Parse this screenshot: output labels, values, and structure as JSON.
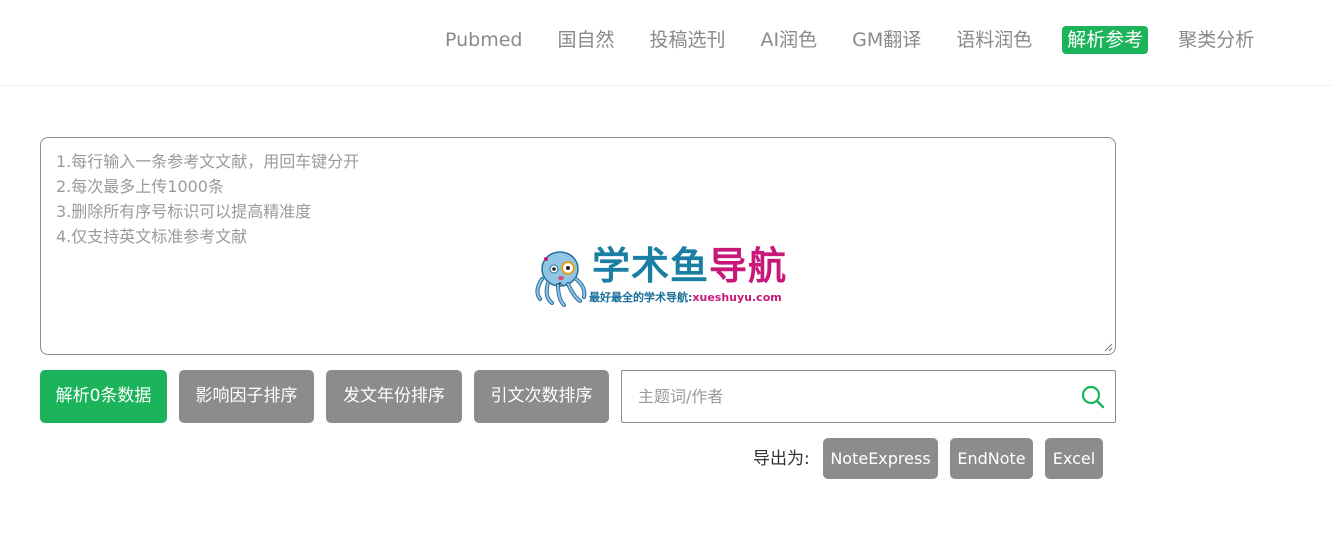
{
  "nav": {
    "items": [
      {
        "label": "Pubmed",
        "active": false
      },
      {
        "label": "国自然",
        "active": false
      },
      {
        "label": "投稿选刊",
        "active": false
      },
      {
        "label": "AI润色",
        "active": false
      },
      {
        "label": "GM翻译",
        "active": false
      },
      {
        "label": "语料润色",
        "active": false
      },
      {
        "label": "解析参考",
        "active": true
      },
      {
        "label": "聚类分析",
        "active": false
      }
    ]
  },
  "reference_input": {
    "value": "",
    "placeholder": "1.每行输入一条参考文文献，用回车键分开\n2.每次最多上传1000条\n3.删除所有序号标识可以提高精准度\n4.仅支持英文标准参考文献"
  },
  "watermark": {
    "title_part1": "学术鱼",
    "title_part2": "导航",
    "subtitle": "最好最全的学术导航:",
    "url": "xueshuyu.com"
  },
  "actions": {
    "parse_label": "解析0条数据",
    "impact_sort_label": "影响因子排序",
    "year_sort_label": "发文年份排序",
    "citation_sort_label": "引文次数排序"
  },
  "search": {
    "value": "",
    "placeholder": "主题词/作者"
  },
  "export": {
    "label": "导出为:",
    "noteexpress_label": "NoteExpress",
    "endnote_label": "EndNote",
    "excel_label": "Excel"
  },
  "colors": {
    "accent": "#1bb45a",
    "button_gray": "#8c8c8c",
    "nav_text": "#8a8a8a"
  }
}
